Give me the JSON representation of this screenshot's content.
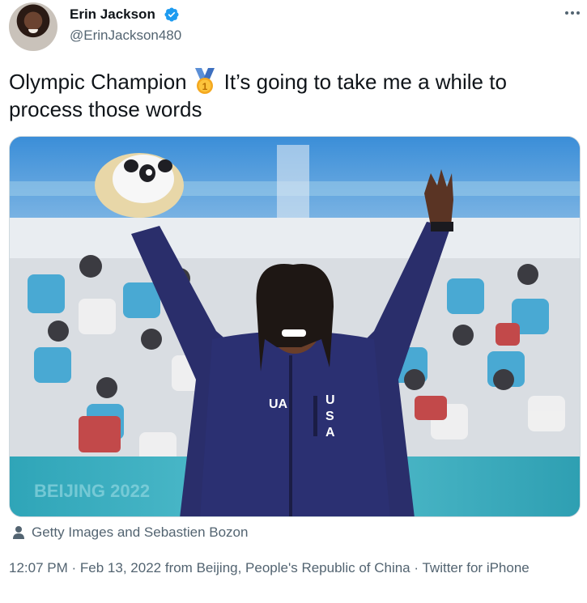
{
  "author": {
    "name": "Erin Jackson",
    "handle": "@ErinJackson480",
    "verified": true
  },
  "tweet": {
    "text_before": "Olympic Champion",
    "emoji": "gold-medal",
    "text_after": "It’s going to take me a while to process those words"
  },
  "media": {
    "type": "photo",
    "alt_subject": "speed skater in USA jacket holding a mascot bouquet, arms raised",
    "credit": "Getty Images and Sebastien Bozon"
  },
  "meta": {
    "time": "12:07 PM",
    "separator": "·",
    "date": "Feb 13, 2022",
    "location_text": "from Beijing, People's Republic of China",
    "source": "Twitter for iPhone"
  },
  "colors": {
    "text": "#0f1419",
    "secondary": "#536471",
    "verified_blue": "#1d9bf0",
    "medal_gold": "#f4a820",
    "ribbon_blue": "#5b8fd6",
    "jacket_navy": "#2a2e6b"
  }
}
